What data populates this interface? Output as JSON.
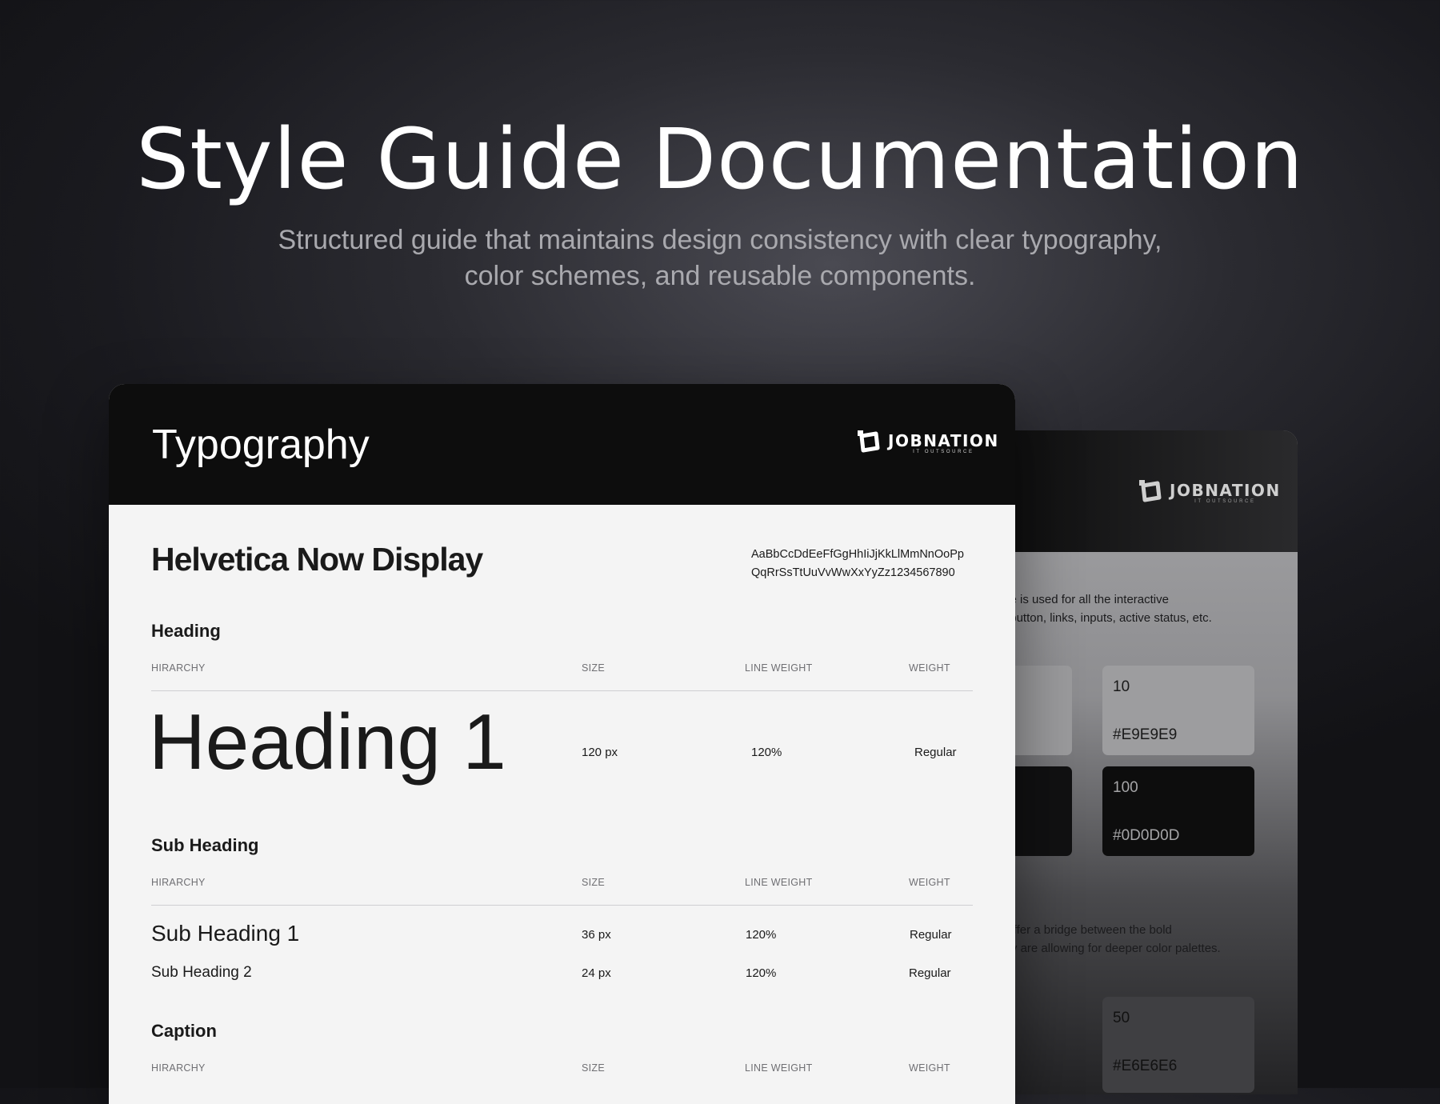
{
  "hero": {
    "title": "Style Guide Documentation",
    "subtitle": "Structured guide that maintains design consistency with clear typography, color schemes, and reusable components."
  },
  "logo": {
    "name": "JOBNATION",
    "tagline": "IT OUTSOURCE",
    "icon": "jobnation-logo-icon"
  },
  "typography_card": {
    "title": "Typography",
    "font_name": "Helvetica Now Display",
    "alphabet_line1": "AaBbCcDdEeFfGgHhIiJjKkLlMmNnOoPp",
    "alphabet_line2": "QqRrSsTtUuVvWwXxYyZz1234567890",
    "columns": {
      "hierarchy": "HIRARCHY",
      "size": "SIZE",
      "line_weight": "LINE WEIGHT",
      "weight": "WEIGHT"
    },
    "heading": {
      "title": "Heading",
      "rows": [
        {
          "label": "Heading 1",
          "size": "120 px",
          "line": "120%",
          "weight": "Regular"
        }
      ]
    },
    "sub_heading": {
      "title": "Sub Heading",
      "rows": [
        {
          "label": "Sub Heading 1",
          "size": "36 px",
          "line": "120%",
          "weight": "Regular"
        },
        {
          "label": "Sub Heading 2",
          "size": "24 px",
          "line": "120%",
          "weight": "Regular"
        }
      ]
    },
    "caption": {
      "title": "Caption"
    }
  },
  "color_card": {
    "text1_line1": "palate is used for all the interactive",
    "text1_line2": "CTA button, links, inputs, active status, etc.",
    "text2_line1": "lors offer a bridge between the bold",
    "text2_line2": ". They are allowing for deeper color palettes.",
    "swatches": [
      {
        "label": "10",
        "hex": "#E9E9E9"
      },
      {
        "label": "100",
        "hex": "#0D0D0D"
      },
      {
        "label": "50",
        "hex": "#E6E6E6"
      }
    ]
  }
}
